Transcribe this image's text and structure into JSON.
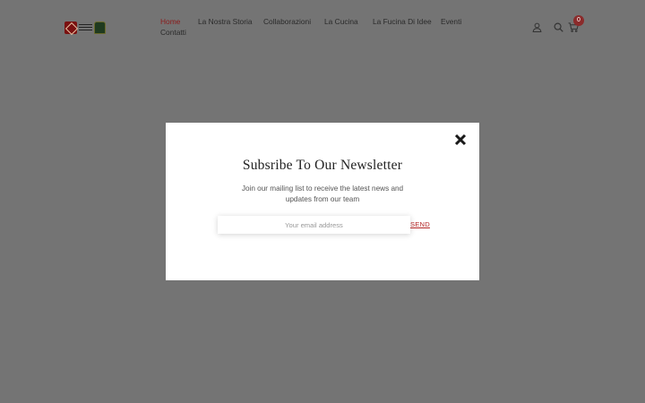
{
  "nav": {
    "items": [
      {
        "label": "Home"
      },
      {
        "label": "La Nostra Storia"
      },
      {
        "label": "Collaborazioni"
      },
      {
        "label": "La Cucina"
      },
      {
        "label": "La Fucina Di Idee"
      },
      {
        "label": "Eventi"
      },
      {
        "label": "Contatti"
      }
    ]
  },
  "header": {
    "cart_count": "0",
    "icons": [
      "user-icon",
      "search-icon",
      "cart-icon"
    ]
  },
  "popup": {
    "title": "Subsribe To Our Newsletter",
    "description": "Join our mailing list to receive the latest news and updates from our team",
    "email_placeholder": "Your email address",
    "send_label": "SEND"
  },
  "colors": {
    "overlay": "#747474",
    "accent": "#8b1a1a",
    "send": "#b32424"
  }
}
